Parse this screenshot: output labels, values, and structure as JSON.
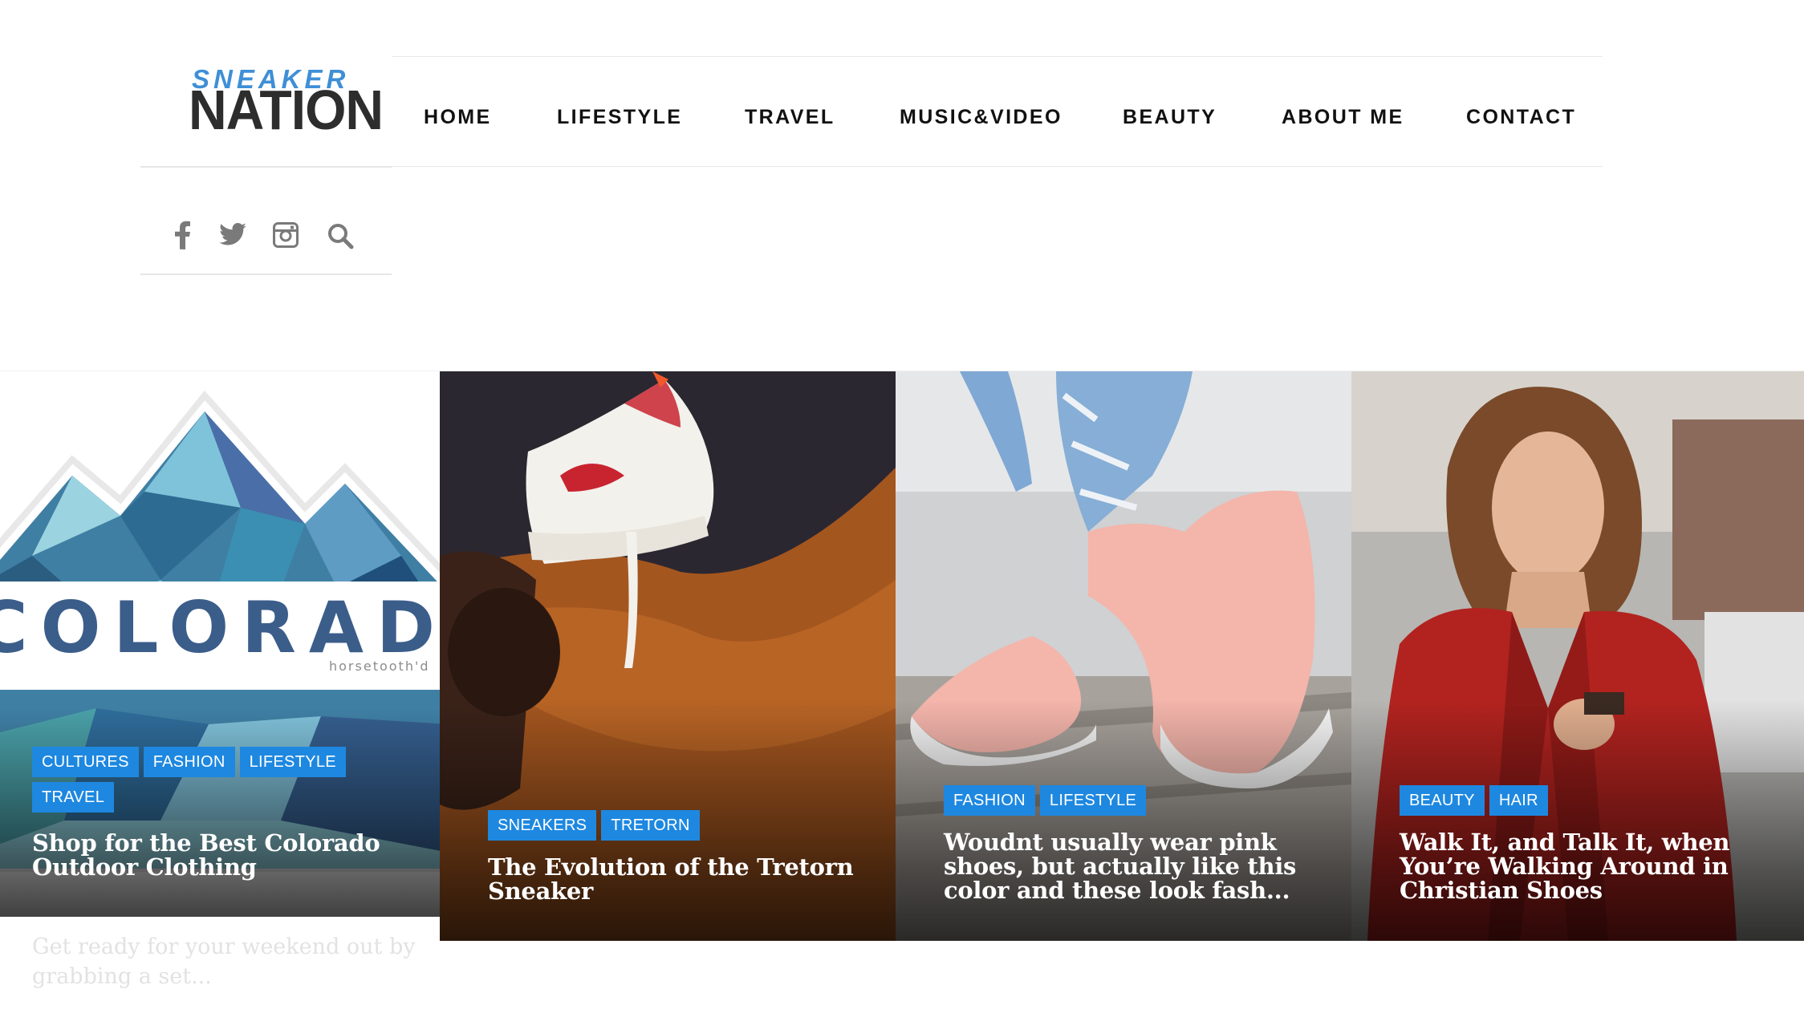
{
  "logo": {
    "top": "SNEAKER",
    "bottom": "NATION"
  },
  "nav": {
    "items": [
      {
        "label": "HOME"
      },
      {
        "label": "LIFESTYLE"
      },
      {
        "label": "TRAVEL"
      },
      {
        "label": "MUSIC&VIDEO"
      },
      {
        "label": "BEAUTY"
      },
      {
        "label": "ABOUT ME"
      },
      {
        "label": "CONTACT"
      }
    ]
  },
  "social": {
    "icons": [
      "facebook-icon",
      "twitter-icon",
      "instagram-icon",
      "search-icon"
    ],
    "icon_color": "#7a7a7a"
  },
  "accent_color": "#1e88e0",
  "posts": [
    {
      "tags": [
        "CULTURES",
        "FASHION",
        "LIFESTYLE",
        "TRAVEL"
      ],
      "title": "Shop for the Best Colorado Outdoor Clothing",
      "image_text": "COLORADO",
      "image_subtext": "horsetooth'd",
      "excerpt": "Get ready for your weekend out by grabbing a set..."
    },
    {
      "tags": [
        "SNEAKERS",
        "TRETORN"
      ],
      "title": "The Evolution of the Tretorn Sneaker"
    },
    {
      "tags": [
        "FASHION",
        "LIFESTYLE"
      ],
      "title": "Woudnt usually wear pink shoes, but actually like this color and these look fash..."
    },
    {
      "tags": [
        "BEAUTY",
        "HAIR"
      ],
      "title": "Walk It, and Talk It, when You’re Walking Around in Christian Shoes"
    }
  ]
}
